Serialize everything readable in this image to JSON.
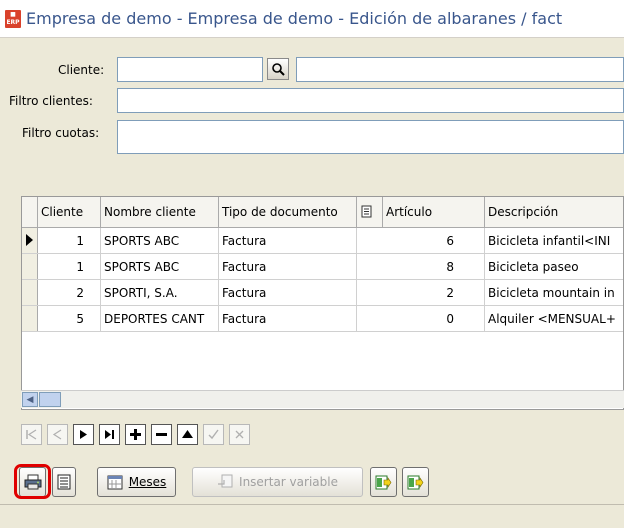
{
  "window": {
    "title": "Empresa de demo - Empresa de demo - Edición de albaranes / fact"
  },
  "form": {
    "cliente_label": "Cliente:",
    "cliente_value": "",
    "cliente_name_value": "",
    "filtro_clientes_label": "Filtro clientes:",
    "filtro_clientes_value": "",
    "filtro_cuotas_label": "Filtro cuotas:",
    "filtro_cuotas_value": ""
  },
  "grid": {
    "columns": [
      "Cliente",
      "Nombre cliente",
      "Tipo de documento",
      "Artículo",
      "Descripción"
    ],
    "rows": [
      {
        "cliente": "1",
        "nombre": "SPORTS ABC",
        "tipo": "Factura",
        "articulo": "6",
        "descripcion": "Bicicleta infantil<INI"
      },
      {
        "cliente": "1",
        "nombre": "SPORTS ABC",
        "tipo": "Factura",
        "articulo": "8",
        "descripcion": "Bicicleta paseo"
      },
      {
        "cliente": "2",
        "nombre": "SPORTI, S.A.",
        "tipo": "Factura",
        "articulo": "2",
        "descripcion": "Bicicleta mountain in"
      },
      {
        "cliente": "5",
        "nombre": "DEPORTES CANT",
        "tipo": "Factura",
        "articulo": "0",
        "descripcion": "Alquiler <MENSUAL+"
      }
    ]
  },
  "toolbar": {
    "meses_label": "Meses",
    "insertar_variable_label": "Insertar variable"
  },
  "icons": {
    "app": "erp-app-icon",
    "search": "magnifier-icon",
    "doc": "document-icon"
  },
  "colors": {
    "title": "#39568c",
    "highlight_ring": "#e00000"
  }
}
